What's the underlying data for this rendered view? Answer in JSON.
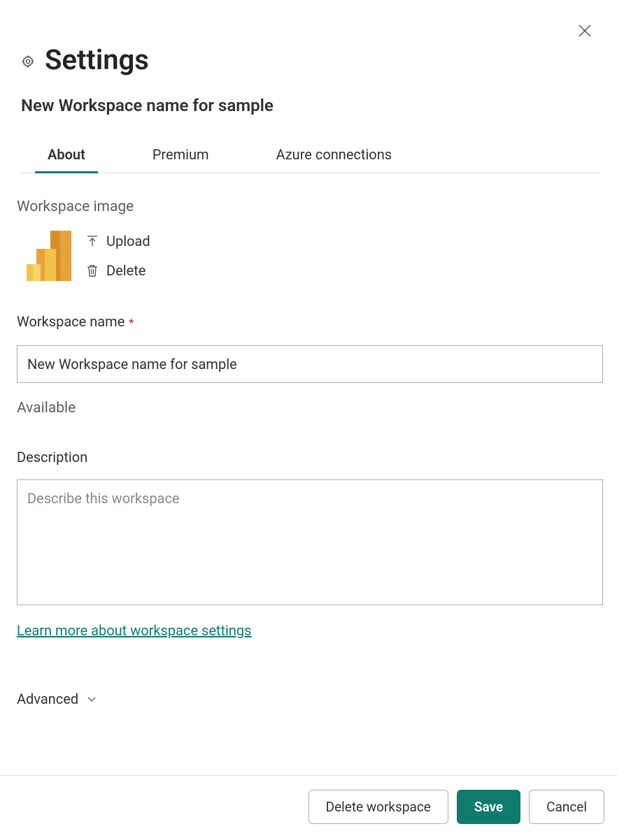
{
  "header": {
    "title": "Settings",
    "subtitle": "New Workspace name for sample"
  },
  "tabs": {
    "items": [
      {
        "label": "About",
        "active": true
      },
      {
        "label": "Premium",
        "active": false
      },
      {
        "label": "Azure connections",
        "active": false
      }
    ]
  },
  "image_section": {
    "label": "Workspace image",
    "upload_label": "Upload",
    "delete_label": "Delete"
  },
  "name_field": {
    "label": "Workspace name",
    "required_mark": "*",
    "value": "New Workspace name for sample",
    "status": "Available"
  },
  "description_field": {
    "label": "Description",
    "placeholder": "Describe this workspace",
    "value": ""
  },
  "learn_link": "Learn more about workspace settings",
  "advanced_label": "Advanced",
  "footer": {
    "delete_label": "Delete workspace",
    "save_label": "Save",
    "cancel_label": "Cancel"
  }
}
